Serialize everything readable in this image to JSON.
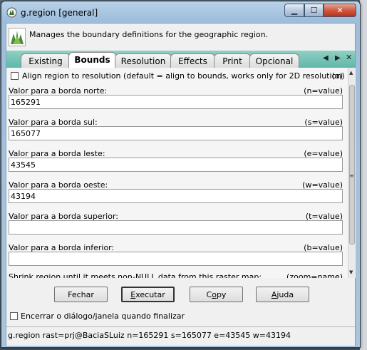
{
  "window": {
    "title": "g.region [general]"
  },
  "header": {
    "description": "Manages the boundary definitions for the geographic region."
  },
  "tabs": [
    {
      "label": "Existing"
    },
    {
      "label": "Bounds"
    },
    {
      "label": "Resolution"
    },
    {
      "label": "Effects"
    },
    {
      "label": "Print"
    },
    {
      "label": "Opcional"
    }
  ],
  "active_tab": "Bounds",
  "tab_nav": {
    "prev": "◀",
    "next": "▶",
    "close": "✕"
  },
  "bounds": {
    "align_option": {
      "label": "Align region to resolution (default = align to bounds, works only for  2D resolution)",
      "flag": "(a)",
      "checked": false
    },
    "fields": [
      {
        "label": "Valor para a borda norte:",
        "hint": "(n=value)",
        "value": "165291"
      },
      {
        "label": "Valor para a borda sul:",
        "hint": "(s=value)",
        "value": "165077"
      },
      {
        "label": "Valor para a borda leste:",
        "hint": "(e=value)",
        "value": "43545"
      },
      {
        "label": "Valor para a borda oeste:",
        "hint": "(w=value)",
        "value": "43194"
      },
      {
        "label": "Valor para a borda superior:",
        "hint": "(t=value)",
        "value": ""
      },
      {
        "label": "Valor para a borda inferior:",
        "hint": "(b=value)",
        "value": ""
      }
    ],
    "shrink_label": "Shrink region until it meets non-NULL data from this raster map:",
    "shrink_hint": "(zoom=name)"
  },
  "buttons": {
    "close": {
      "pre": "Fechar",
      "ul": "",
      "post": ""
    },
    "run": {
      "pre": "",
      "ul": "E",
      "post": "xecutar"
    },
    "copy": {
      "pre": "C",
      "ul": "o",
      "post": "py"
    },
    "help": {
      "pre": "",
      "ul": "A",
      "post": "juda"
    }
  },
  "close_on_finish": {
    "label": "Encerrar o diálogo/janela quando finalizar",
    "checked": false
  },
  "status_command": "g.region rast=prj@BaciaSLuiz n=165291 s=165077 e=43545 w=43194",
  "colors": {
    "tab_strip": "#5fb8a8",
    "close_button": "#cf5a42",
    "title_bar": "#a9c5df"
  }
}
